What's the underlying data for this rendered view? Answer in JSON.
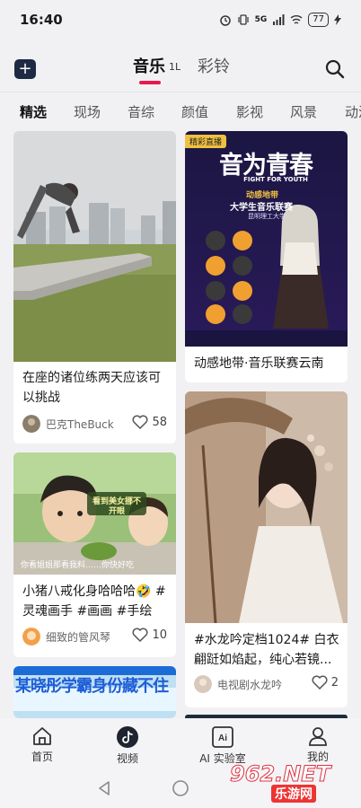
{
  "status": {
    "time": "16:40",
    "network": "5G",
    "battery": "77"
  },
  "header": {
    "tabs": [
      {
        "label": "音乐",
        "active": true
      },
      {
        "label": "彩铃",
        "active": false
      }
    ],
    "music_badge": "1L"
  },
  "categories": [
    "精选",
    "现场",
    "音综",
    "颜值",
    "影视",
    "风景",
    "动漫"
  ],
  "feed": {
    "left": [
      {
        "title": "在座的诸位练两天应该可以挑战",
        "author": "巴克TheBuck",
        "likes": "58"
      },
      {
        "title": "小猪八戒化身哈哈哈🤣 #灵魂画手 #画画 #手绘",
        "author": "细致的管风琴",
        "likes": "10",
        "overlay_top": "看到美女挪不开眼",
        "overlay_bottom": "你看姐姐那看我料……你快好吃"
      },
      {
        "banner": "某晓彤学霸身份藏不住"
      }
    ],
    "right": [
      {
        "tag": "精彩直播",
        "poster_title": "音为青春",
        "poster_sub": "FIGHT FOR YOUTH",
        "poster_line1": "动感地带",
        "poster_line2": "大学生音乐联赛",
        "poster_line3": "昆明理工大学",
        "title": "动感地带·音乐联赛云南"
      },
      {
        "title": "#水龙吟定档1024# 白衣翩跹如焰起，纯心若镜...",
        "author": "电视剧水龙吟",
        "likes": "2"
      }
    ]
  },
  "bottom_nav": [
    {
      "label": "首页",
      "icon": "home-icon"
    },
    {
      "label": "视频",
      "icon": "tiktok-icon"
    },
    {
      "label": "AI 实验室",
      "icon": "ai-icon"
    },
    {
      "label": "我的",
      "icon": "profile-icon"
    }
  ],
  "watermark": {
    "main": "962.NET",
    "sub": "乐游网"
  }
}
